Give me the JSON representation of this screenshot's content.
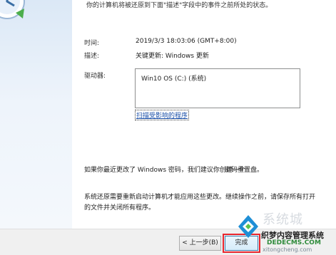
{
  "intro": "你的计算机将被还原到下面\"描述\"字段中的事件之前所处的状态。",
  "fields": {
    "time_label": "时间:",
    "time_value": "2019/3/3 18:03:06 (GMT+8:00)",
    "description_label": "描述:",
    "description_value": "关键更新: Windows 更新",
    "drive_label": "驱动器:",
    "drives": [
      "Win10 OS  (C:) (系统)"
    ]
  },
  "scan_link": "扫描受影响的程序",
  "password_note": "如果你最近更改了 Windows 密码，我们建议你创建一个",
  "create_disk_link": "密码重置盘。",
  "restart_note": "系统还原需要重新启动计算机才能应用这些更改。继续操作之前，请保存所有打开的文件并关闭所有程序。",
  "buttons": {
    "back": "< 上一步(B)",
    "finish": "完成"
  },
  "watermark": {
    "title": "系统城",
    "name": "织梦内容管理系统",
    "url": "DEDECMS.COM",
    "url2": "xitongcheng.com"
  },
  "colors": {
    "link": "#1a4fa8",
    "highlight": "#e8262e",
    "watermark_url": "#2e8b3a"
  }
}
